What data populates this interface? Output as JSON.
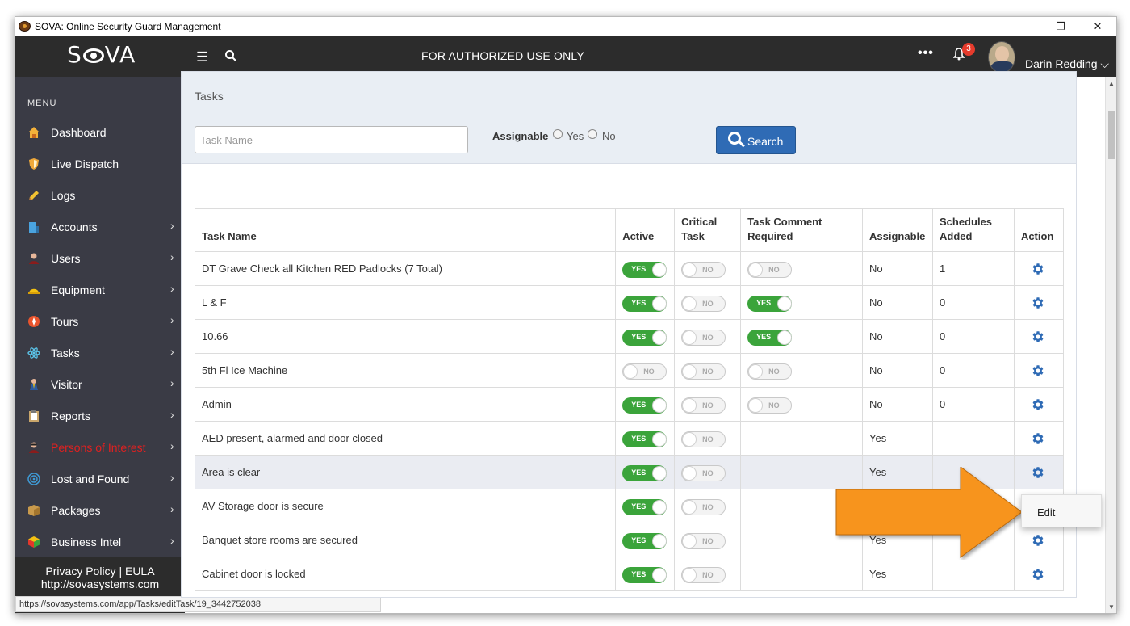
{
  "window": {
    "title": "SOVA: Online Security Guard Management",
    "controls": {
      "minimize": "—",
      "restore": "❐",
      "close": "✕"
    }
  },
  "topbar": {
    "logo": "SOVA",
    "banner": "FOR AUTHORIZED USE ONLY",
    "notification_count": "3",
    "user_name": "Darin Redding"
  },
  "sidebar": {
    "menu_label": "MENU",
    "items": [
      {
        "label": "Dashboard",
        "icon": "home-icon",
        "has_children": false
      },
      {
        "label": "Live Dispatch",
        "icon": "shield-icon",
        "has_children": false
      },
      {
        "label": "Logs",
        "icon": "pencil-icon",
        "has_children": false
      },
      {
        "label": "Accounts",
        "icon": "building-icon",
        "has_children": true
      },
      {
        "label": "Users",
        "icon": "user-icon",
        "has_children": true
      },
      {
        "label": "Equipment",
        "icon": "hardhat-icon",
        "has_children": true
      },
      {
        "label": "Tours",
        "icon": "compass-icon",
        "has_children": true
      },
      {
        "label": "Tasks",
        "icon": "atom-icon",
        "has_children": true
      },
      {
        "label": "Visitor",
        "icon": "visitor-icon",
        "has_children": true
      },
      {
        "label": "Reports",
        "icon": "clipboard-icon",
        "has_children": true
      },
      {
        "label": "Persons of Interest",
        "icon": "suspect-icon",
        "has_children": true,
        "color": "#e02020"
      },
      {
        "label": "Lost and Found",
        "icon": "target-icon",
        "has_children": true
      },
      {
        "label": "Packages",
        "icon": "box-icon",
        "has_children": true
      },
      {
        "label": "Business Intel",
        "icon": "cube-icon",
        "has_children": true
      }
    ],
    "footer": {
      "privacy": "Privacy Policy",
      "separator": "|",
      "eula": "EULA",
      "website": "http://sovasystems.com"
    }
  },
  "panel": {
    "title": "Tasks",
    "search_placeholder": "Task Name",
    "assignable_label": "Assignable",
    "radio_yes": "Yes",
    "radio_no": "No",
    "search_button": "Search"
  },
  "table": {
    "headers": {
      "task_name": "Task Name",
      "active": "Active",
      "critical_1": "Critical",
      "critical_2": "Task",
      "comment_1": "Task Comment",
      "comment_2": "Required",
      "assignable": "Assignable",
      "schedules_1": "Schedules",
      "schedules_2": "Added",
      "action": "Action"
    },
    "toggle_on": "YES",
    "toggle_off": "NO",
    "rows": [
      {
        "name": "DT Grave Check all Kitchen RED Padlocks (7 Total)",
        "active": true,
        "critical": false,
        "comment": false,
        "assignable": "No",
        "schedules": "1"
      },
      {
        "name": "L & F",
        "active": true,
        "critical": false,
        "comment": true,
        "assignable": "No",
        "schedules": "0"
      },
      {
        "name": "10.66",
        "active": true,
        "critical": false,
        "comment": true,
        "assignable": "No",
        "schedules": "0"
      },
      {
        "name": "5th Fl Ice Machine",
        "active": false,
        "critical": false,
        "comment": false,
        "assignable": "No",
        "schedules": "0"
      },
      {
        "name": "Admin",
        "active": true,
        "critical": false,
        "comment": false,
        "assignable": "No",
        "schedules": "0"
      },
      {
        "name": "AED present, alarmed and door closed",
        "active": true,
        "critical": false,
        "comment": null,
        "assignable": "Yes",
        "schedules": ""
      },
      {
        "name": "Area is clear",
        "active": true,
        "critical": false,
        "comment": null,
        "assignable": "Yes",
        "schedules": "",
        "highlighted": true
      },
      {
        "name": "AV Storage door is secure",
        "active": true,
        "critical": false,
        "comment": null,
        "assignable": "",
        "schedules": ""
      },
      {
        "name": "Banquet store rooms are secured",
        "active": true,
        "critical": false,
        "comment": null,
        "assignable": "Yes",
        "schedules": ""
      },
      {
        "name": "Cabinet door is locked",
        "active": true,
        "critical": false,
        "comment": null,
        "assignable": "Yes",
        "schedules": ""
      }
    ]
  },
  "dropdown": {
    "edit": "Edit"
  },
  "statusbar": {
    "url": "https://sovasystems.com/app/Tasks/editTask/19_3442752038"
  },
  "colors": {
    "accent_blue": "#2f6bb5",
    "toggle_green": "#3ba43b",
    "arrow_orange": "#f7941d",
    "danger_red": "#e02020"
  }
}
